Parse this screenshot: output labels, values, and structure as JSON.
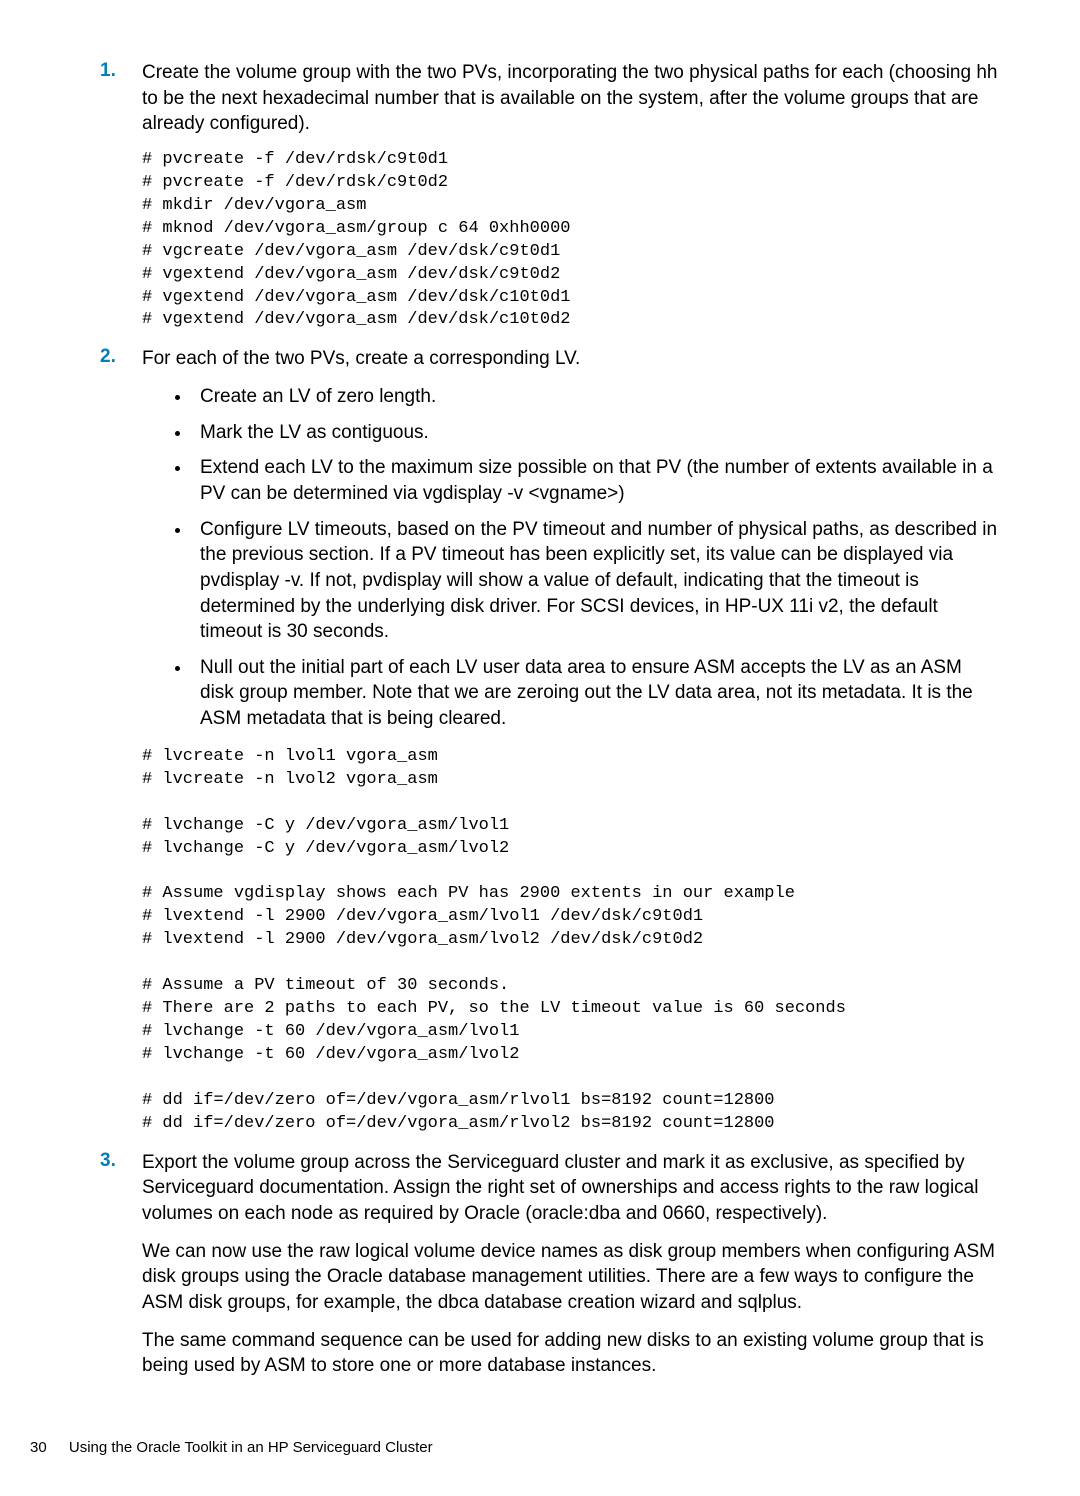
{
  "steps": [
    {
      "num": "1.",
      "intro": "Create the volume group with the two PVs, incorporating the two physical paths for each (choosing hh to be the next hexadecimal number that is available on the system, after the volume groups that are already configured).",
      "code1": "# pvcreate -f /dev/rdsk/c9t0d1\n# pvcreate -f /dev/rdsk/c9t0d2\n# mkdir /dev/vgora_asm\n# mknod /dev/vgora_asm/group c 64 0xhh0000\n# vgcreate /dev/vgora_asm /dev/dsk/c9t0d1\n# vgextend /dev/vgora_asm /dev/dsk/c9t0d2\n# vgextend /dev/vgora_asm /dev/dsk/c10t0d1\n# vgextend /dev/vgora_asm /dev/dsk/c10t0d2"
    },
    {
      "num": "2.",
      "intro": "For each of the two PVs, create a corresponding LV.",
      "bullets": [
        "Create an LV of zero length.",
        "Mark the LV as contiguous.",
        "Extend each LV to the maximum size possible on that PV (the number of extents available in a PV can be determined via vgdisplay -v <vgname>)",
        "Configure LV timeouts, based on the PV timeout and number of physical paths, as described in the previous section. If a PV timeout has been explicitly set, its value can be displayed via pvdisplay -v. If not, pvdisplay will show a value of default, indicating that the timeout is determined by the underlying disk driver. For SCSI devices, in HP-UX 11i v2, the default timeout is 30 seconds.",
        "Null out the initial part of each LV user data area to ensure ASM accepts the LV as an ASM disk group member. Note that we are zeroing out the LV data area, not its metadata. It is the ASM metadata that is being cleared."
      ],
      "code1": "# lvcreate -n lvol1 vgora_asm\n# lvcreate -n lvol2 vgora_asm\n\n# lvchange -C y /dev/vgora_asm/lvol1\n# lvchange -C y /dev/vgora_asm/lvol2\n\n# Assume vgdisplay shows each PV has 2900 extents in our example\n# lvextend -l 2900 /dev/vgora_asm/lvol1 /dev/dsk/c9t0d1\n# lvextend -l 2900 /dev/vgora_asm/lvol2 /dev/dsk/c9t0d2\n\n# Assume a PV timeout of 30 seconds.\n# There are 2 paths to each PV, so the LV timeout value is 60 seconds\n# lvchange -t 60 /dev/vgora_asm/lvol1\n# lvchange -t 60 /dev/vgora_asm/lvol2\n\n# dd if=/dev/zero of=/dev/vgora_asm/rlvol1 bs=8192 count=12800\n# dd if=/dev/zero of=/dev/vgora_asm/rlvol2 bs=8192 count=12800"
    },
    {
      "num": "3.",
      "intro": "Export the volume group across the Serviceguard cluster and mark it as exclusive, as specified by Serviceguard documentation. Assign the right set of ownerships and access rights to the raw logical volumes on each node as required by Oracle (oracle:dba and 0660, respectively).",
      "para2": "We can now use the raw logical volume device names as disk group members when configuring ASM disk groups using the Oracle database management utilities. There are a few ways to configure the ASM disk groups, for example, the dbca database creation wizard and sqlplus.",
      "para3": "The same command sequence can be used for adding new disks to an existing volume group that is being used by ASM to store one or more database instances."
    }
  ],
  "footer": {
    "pagenum": "30",
    "title": "Using the Oracle Toolkit in an HP Serviceguard Cluster"
  }
}
